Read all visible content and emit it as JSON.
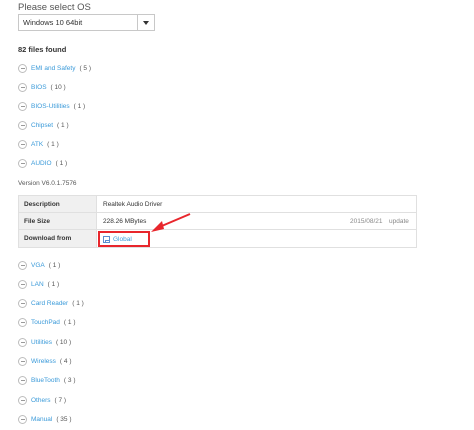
{
  "os_selector": {
    "label": "Please select OS",
    "value": "Windows 10 64bit"
  },
  "files_found": "82 files found",
  "categories_before": [
    {
      "name": "EMI and Safety",
      "count": "( 5 )"
    },
    {
      "name": "BIOS",
      "count": "( 10 )"
    },
    {
      "name": "BIOS-Utilities",
      "count": "( 1 )"
    },
    {
      "name": "Chipset",
      "count": "( 1 )"
    },
    {
      "name": "ATK",
      "count": "( 1 )"
    },
    {
      "name": "AUDIO",
      "count": "( 1 )"
    }
  ],
  "driver": {
    "version": "Version V6.0.1.7576",
    "description_label": "Description",
    "description_value": "Realtek Audio Driver",
    "filesize_label": "File Size",
    "filesize_value": "228.26 MBytes",
    "date": "2015/08/21",
    "update": "update",
    "download_label": "Download from",
    "download_link": "Global"
  },
  "categories_after": [
    {
      "name": "VGA",
      "count": "( 1 )"
    },
    {
      "name": "LAN",
      "count": "( 1 )"
    },
    {
      "name": "Card Reader",
      "count": "( 1 )"
    },
    {
      "name": "TouchPad",
      "count": "( 1 )"
    },
    {
      "name": "Utilities",
      "count": "( 10 )"
    },
    {
      "name": "Wireless",
      "count": "( 4 )"
    },
    {
      "name": "BlueTooth",
      "count": "( 3 )"
    },
    {
      "name": "Others",
      "count": "( 7 )"
    },
    {
      "name": "Manual",
      "count": "( 35 )"
    }
  ],
  "colors": {
    "link": "#3a9ad9",
    "highlight": "#e8262c"
  }
}
